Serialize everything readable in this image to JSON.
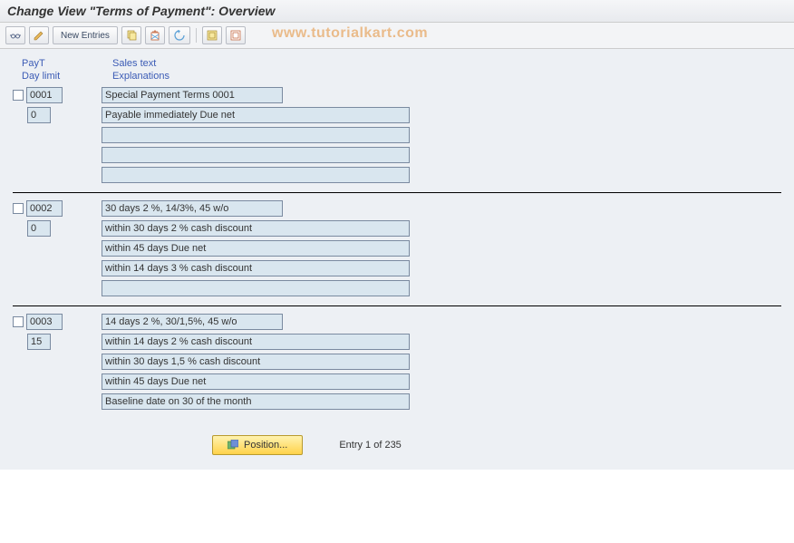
{
  "title": "Change View \"Terms of Payment\": Overview",
  "watermark": "www.tutorialkart.com",
  "toolbar": {
    "new_entries": "New Entries"
  },
  "headers": {
    "payt": "PayT",
    "sales_text": "Sales text",
    "day_limit": "Day limit",
    "explanations": "Explanations"
  },
  "entries": [
    {
      "payt": "0001",
      "day_limit": "0",
      "sales_text": "Special Payment Terms 0001",
      "lines": [
        "Payable immediately Due net",
        "",
        "",
        ""
      ]
    },
    {
      "payt": "0002",
      "day_limit": "0",
      "sales_text": "30 days 2 %, 14/3%, 45 w/o",
      "lines": [
        "within 30 days 2 % cash discount",
        "within 45 days Due net",
        "within 14 days 3 % cash discount",
        ""
      ]
    },
    {
      "payt": "0003",
      "day_limit": "15",
      "sales_text": "14 days 2 %, 30/1,5%, 45 w/o",
      "lines": [
        "within 14 days 2 % cash discount",
        "within 30 days 1,5 % cash discount",
        "within 45 days Due net",
        "Baseline date on 30 of the month"
      ]
    }
  ],
  "footer": {
    "position": "Position...",
    "entry_count": "Entry 1 of 235"
  }
}
